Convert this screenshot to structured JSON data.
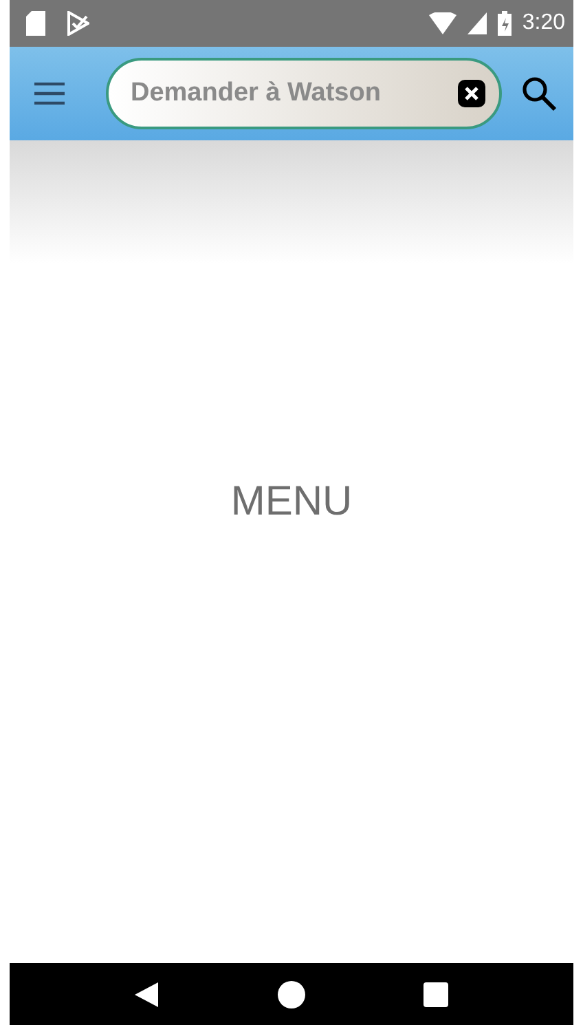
{
  "status_bar": {
    "time": "3:20"
  },
  "search": {
    "placeholder": "Demander à Watson"
  },
  "content": {
    "label": "MENU"
  }
}
